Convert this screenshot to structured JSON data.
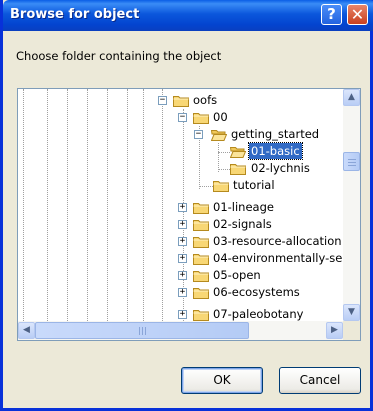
{
  "window": {
    "title": "Browse for object",
    "help_icon_glyph": "?",
    "close_icon_glyph": "✕"
  },
  "instruction": "Choose folder containing the object",
  "tree": {
    "nodes": [
      {
        "label": "oofs",
        "expander": "−"
      },
      {
        "label": "00",
        "expander": "−"
      },
      {
        "label": "getting_started",
        "expander": "−"
      },
      {
        "label": "01-basic",
        "selected": true
      },
      {
        "label": "02-lychnis"
      },
      {
        "label": "tutorial"
      },
      {
        "label": "01-lineage",
        "expander": "+"
      },
      {
        "label": "02-signals",
        "expander": "+"
      },
      {
        "label": "03-resource-allocation",
        "expander": "+"
      },
      {
        "label": "04-environmentally-se",
        "expander": "+"
      },
      {
        "label": "05-open",
        "expander": "+"
      },
      {
        "label": "06-ecosystems",
        "expander": "+"
      },
      {
        "label": "07-paleobotany",
        "expander": "+"
      }
    ]
  },
  "scroll": {
    "up_arrow": "▲",
    "down_arrow": "▼",
    "left_arrow": "◀",
    "right_arrow": "▶"
  },
  "buttons": {
    "ok": "OK",
    "cancel": "Cancel"
  },
  "colors": {
    "titlebar": "#0a5ee6",
    "selection": "#316ac5",
    "dialog_bg": "#ece9d8"
  }
}
